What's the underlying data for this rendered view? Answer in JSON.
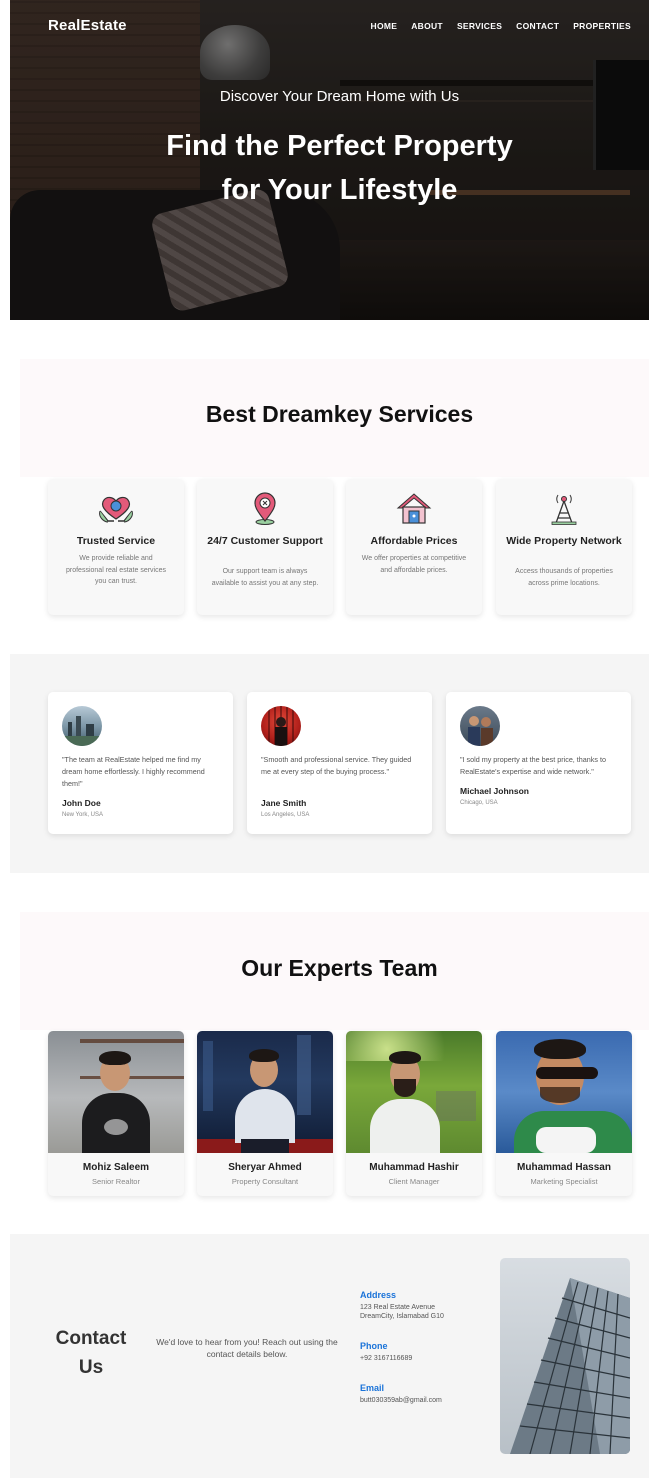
{
  "brand": "RealEstate",
  "nav": [
    "HOME",
    "ABOUT",
    "SERVICES",
    "CONTACT",
    "PROPERTIES"
  ],
  "hero": {
    "subtitle": "Discover Your Dream Home with Us",
    "title_line1": "Find the Perfect Property",
    "title_line2": "for Your Lifestyle"
  },
  "services": {
    "title": "Best Dreamkey Services",
    "items": [
      {
        "title": "Trusted Service",
        "desc": "We provide reliable and professional real estate services you can trust.",
        "icon": "heart-hands-icon"
      },
      {
        "title": "24/7 Customer Support",
        "desc": "Our support team is always available to assist you at any step.",
        "icon": "location-support-icon"
      },
      {
        "title": "Affordable Prices",
        "desc": "We offer properties at competitive and affordable prices.",
        "icon": "house-icon"
      },
      {
        "title": "Wide Property Network",
        "desc": "Access thousands of properties across prime locations.",
        "icon": "antenna-tower-icon"
      }
    ]
  },
  "testimonials": [
    {
      "quote": "\"The team at RealEstate helped me find my dream home effortlessly. I highly recommend them!\"",
      "name": "John Doe",
      "location": "New York, USA"
    },
    {
      "quote": "\"Smooth and professional service. They guided me at every step of the buying process.\"",
      "name": "Jane Smith",
      "location": "Los Angeles, USA"
    },
    {
      "quote": "\"I sold my property at the best price, thanks to RealEstate's expertise and wide network.\"",
      "name": "Michael Johnson",
      "location": "Chicago, USA"
    }
  ],
  "team": {
    "title": "Our Experts Team",
    "members": [
      {
        "name": "Mohiz Saleem",
        "role": "Senior Realtor"
      },
      {
        "name": "Sheryar Ahmed",
        "role": "Property Consultant"
      },
      {
        "name": "Muhammad Hashir",
        "role": "Client Manager"
      },
      {
        "name": "Muhammad Hassan",
        "role": "Marketing Specialist"
      }
    ]
  },
  "contact": {
    "title_line1": "Contact",
    "title_line2": "Us",
    "desc": "We'd love to hear from you! Reach out using the contact details below.",
    "address_label": "Address",
    "address_line1": "123 Real Estate Avenue",
    "address_line2": "DreamCity, Islamabad G10",
    "phone_label": "Phone",
    "phone": "+92 3167116689",
    "email_label": "Email",
    "email": "butt030359ab@gmail.com"
  }
}
